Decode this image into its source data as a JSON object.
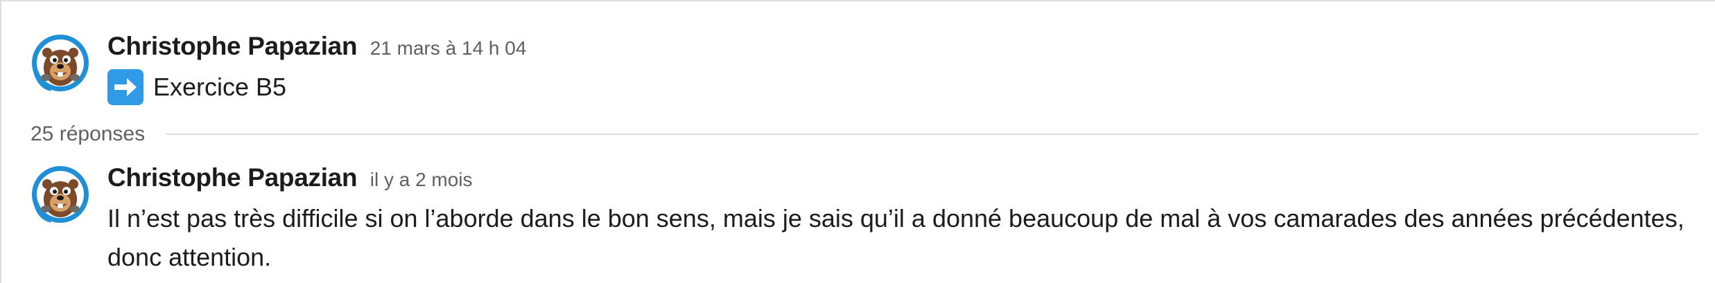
{
  "thread": {
    "parent": {
      "author": "Christophe Papazian",
      "timestamp": "21 mars à 14 h 04",
      "emoji": "arrow-right-emoji",
      "text": "Exercice B5"
    },
    "reply_count_label": "25 réponses",
    "reply": {
      "author": "Christophe Papazian",
      "timestamp": "il y a 2 mois",
      "text": "Il n’est pas très difficile si on l’aborde dans le bon sens, mais je sais qu’il a donné beaucoup de mal à vos camarades des années précédentes, donc attention."
    }
  },
  "colors": {
    "author": "#1d1c1d",
    "timestamp": "#616061",
    "divider": "#dddddd",
    "emoji_blue": "#2f9be6",
    "avatar_ring": "#1f8fd6"
  }
}
